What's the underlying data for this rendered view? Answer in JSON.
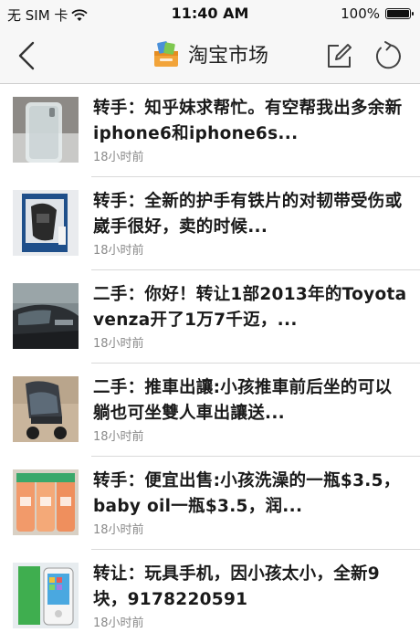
{
  "status_bar": {
    "carrier": "无 SIM 卡",
    "time": "11:40 AM",
    "battery_text": "100%",
    "battery_level": 1.0
  },
  "nav": {
    "title": "淘宝市场",
    "back_icon": "chevron-left-icon",
    "edit_icon": "compose-icon",
    "refresh_icon": "refresh-icon"
  },
  "items": [
    {
      "title": "转手：知乎妹求帮忙。有空帮我出多余新iphone6和iphone6s...",
      "time": "18小时前",
      "thumb": "phone-case"
    },
    {
      "title": "转手：全新的护手有铁片的对韧带受伤或崴手很好，卖的时候...",
      "time": "18小时前",
      "thumb": "wrist-brace"
    },
    {
      "title": "二手：你好！转让1部2013年的Toyota venza开了1万7千迈，...",
      "time": "18小时前",
      "thumb": "car"
    },
    {
      "title": "二手：推車出讓:小孩推車前后坐的可以躺也可坐雙人車出讓送...",
      "time": "18小时前",
      "thumb": "stroller"
    },
    {
      "title": "转手：便宜出售:小孩洗澡的一瓶$3.5，baby oil一瓶$3.5，润...",
      "time": "18小时前",
      "thumb": "bottles"
    },
    {
      "title": "转让：玩具手机，因小孩太小，全新9块，9178220591",
      "time": "18小时前",
      "thumb": "toy-phone"
    }
  ]
}
